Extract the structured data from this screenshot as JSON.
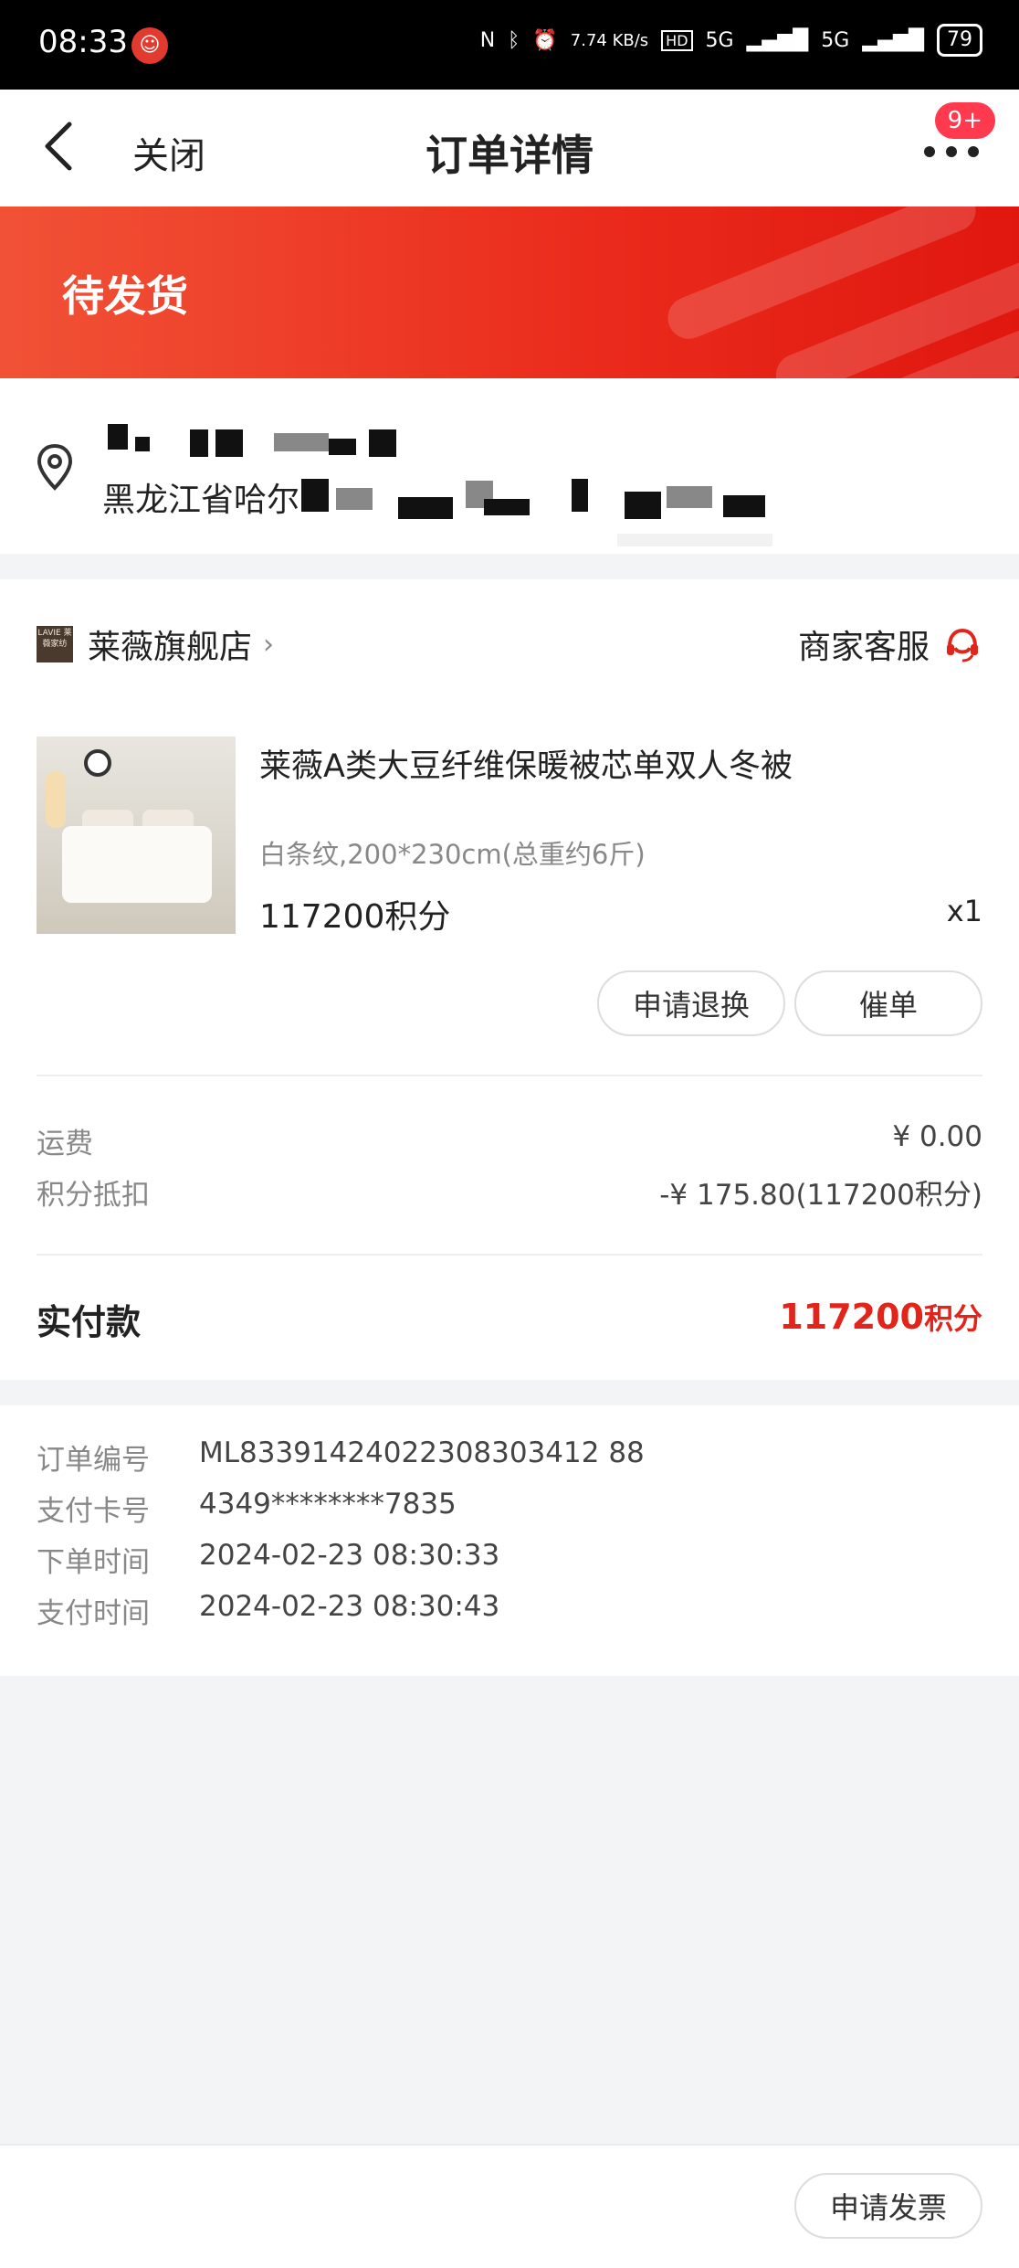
{
  "status_bar": {
    "time": "08:33",
    "network_speed": "7.74 KB/s",
    "signal_1": "5G",
    "signal_2": "5G",
    "battery": "79"
  },
  "nav": {
    "close_label": "关闭",
    "title": "订单详情",
    "badge": "9+"
  },
  "order_status": "待发货",
  "address": {
    "line2_visible": "黑龙江省哈尔"
  },
  "shop": {
    "name": "莱薇旗舰店",
    "logo_text": "LAVIE 莱薇家纺",
    "service_label": "商家客服"
  },
  "product": {
    "title": "莱薇A类大豆纤维保暖被芯单双人冬被",
    "spec": "白条纹,200*230cm(总重约6斤)",
    "price": "117200积分",
    "qty": "x1"
  },
  "actions": {
    "refund": "申请退换",
    "urge": "催单"
  },
  "fees": [
    {
      "label": "运费",
      "value": "¥ 0.00"
    },
    {
      "label": "积分抵扣",
      "value": "-¥ 175.80(117200积分)"
    }
  ],
  "paid": {
    "label": "实付款",
    "amount": "117200",
    "unit": "积分"
  },
  "info": [
    {
      "label": "订单编号",
      "value": "ML83391424022308303412 88"
    },
    {
      "label": "支付卡号",
      "value": "4349********7835"
    },
    {
      "label": "下单时间",
      "value": "2024-02-23 08:30:33"
    },
    {
      "label": "支付时间",
      "value": "2024-02-23 08:30:43"
    }
  ],
  "bottom": {
    "invoice_label": "申请发票"
  },
  "colors": {
    "accent": "#e1251b",
    "banner_start": "#f15236",
    "banner_end": "#e0170f",
    "badge": "#ff3a4f"
  }
}
